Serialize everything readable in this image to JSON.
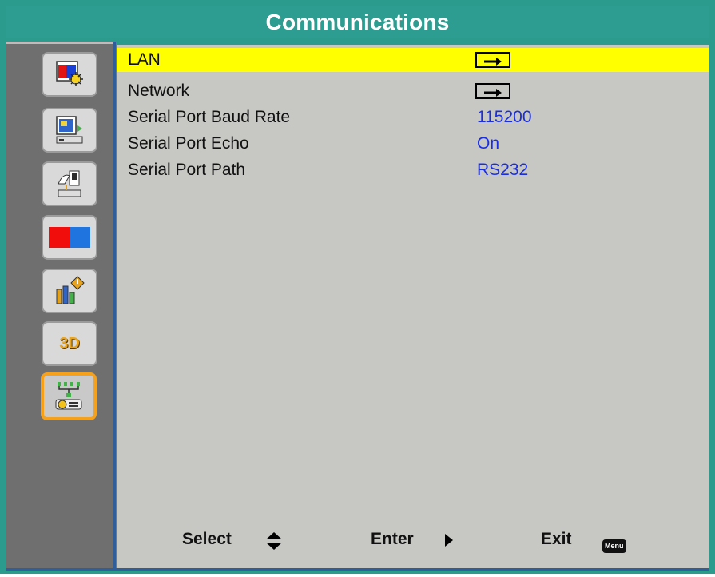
{
  "header": {
    "title": "Communications"
  },
  "sidebar": {
    "items": [
      {
        "icon": "picture-settings-icon"
      },
      {
        "icon": "display-settings-icon"
      },
      {
        "icon": "setup-icon"
      },
      {
        "icon": "color-settings-icon"
      },
      {
        "icon": "information-icon"
      },
      {
        "icon": "3d-icon",
        "label": "3D"
      },
      {
        "icon": "communications-icon",
        "active": true
      }
    ]
  },
  "menu": {
    "rows": [
      {
        "label": "LAN",
        "value": "",
        "type": "submenu",
        "selected": true
      },
      {
        "label": "Network",
        "value": "",
        "type": "submenu"
      },
      {
        "label": "Serial Port Baud Rate",
        "value": "115200"
      },
      {
        "label": "Serial Port Echo",
        "value": "On"
      },
      {
        "label": "Serial Port Path",
        "value": "RS232"
      }
    ]
  },
  "footer": {
    "select_label": "Select",
    "enter_label": "Enter",
    "exit_label": "Exit",
    "menu_key_label": "Menu"
  },
  "colors": {
    "title_bar": "#2c9d90",
    "selection": "#ffff00",
    "value_text": "#1a2ee0",
    "active_tile_border": "#f5a11c"
  }
}
